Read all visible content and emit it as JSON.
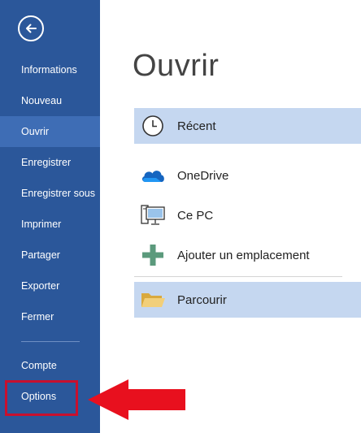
{
  "sidebar": {
    "back_icon": "arrow-left-circle-icon",
    "items": [
      {
        "label": "Informations"
      },
      {
        "label": "Nouveau"
      },
      {
        "label": "Ouvrir",
        "active": true
      },
      {
        "label": "Enregistrer"
      },
      {
        "label": "Enregistrer sous"
      },
      {
        "label": "Imprimer"
      },
      {
        "label": "Partager"
      },
      {
        "label": "Exporter"
      },
      {
        "label": "Fermer"
      }
    ],
    "footer_items": [
      {
        "label": "Compte"
      },
      {
        "label": "Options"
      }
    ],
    "background_color": "#2b579a",
    "active_color": "#3e6db5"
  },
  "main": {
    "title": "Ouvrir",
    "locations": [
      {
        "label": "Récent",
        "icon": "clock-icon",
        "selected": true
      },
      {
        "label": "OneDrive",
        "icon": "cloud-icon"
      },
      {
        "label": "Ce PC",
        "icon": "computer-icon"
      },
      {
        "label": "Ajouter un emplacement",
        "icon": "plus-icon"
      },
      {
        "label": "Parcourir",
        "icon": "folder-icon",
        "selected": true
      }
    ],
    "selected_color": "#c5d7f0"
  },
  "annotation": {
    "highlight_color": "#c8102e",
    "arrow_color": "#e8101e",
    "target": "Options"
  }
}
